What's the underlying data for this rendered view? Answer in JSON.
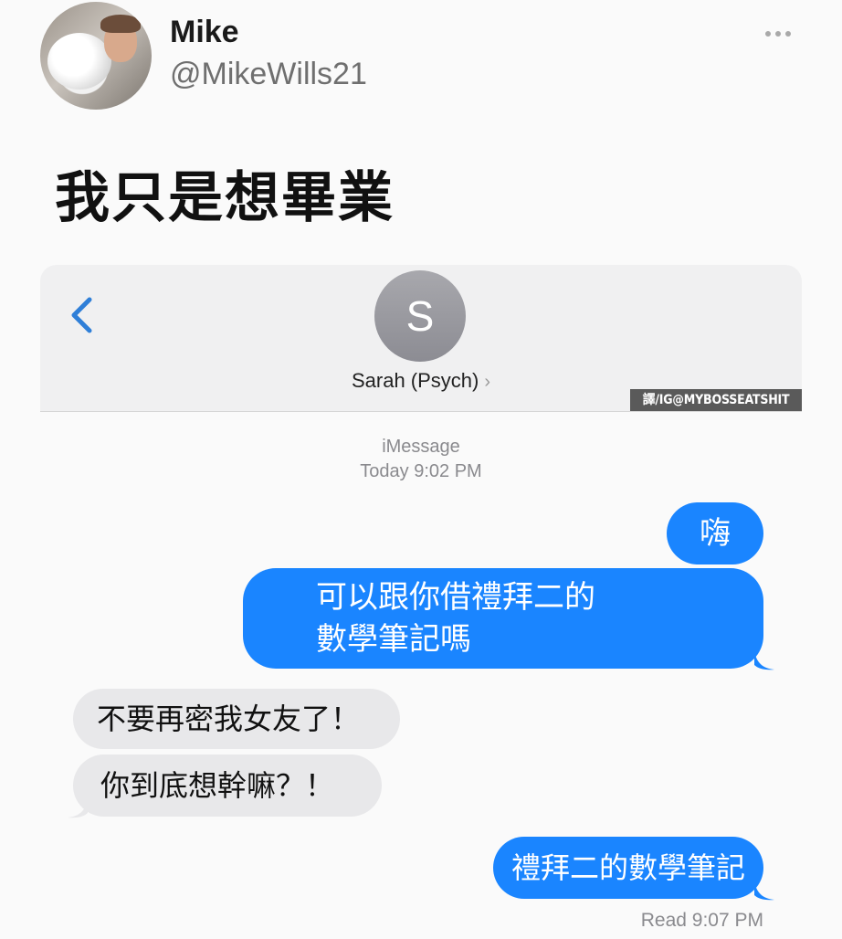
{
  "tweet": {
    "user_name": "Mike",
    "user_handle": "@MikeWills21",
    "text": "我只是想畢業"
  },
  "conversation": {
    "contact_initial": "S",
    "contact_name": "Sarah (Psych)",
    "watermark": "譯/IG@MYBOSSEATSHIT",
    "service": "iMessage",
    "timestamp": "Today 9:02 PM",
    "messages": [
      {
        "direction": "sent",
        "text": "嗨"
      },
      {
        "direction": "sent",
        "line1": "可以跟你借禮拜二的",
        "line2": "數學筆記嗎"
      },
      {
        "direction": "received",
        "text": "不要再密我女友了！"
      },
      {
        "direction": "received",
        "text": "你到底想幹嘛？！"
      },
      {
        "direction": "sent",
        "text": "禮拜二的數學筆記"
      }
    ],
    "read_receipt": "Read 9:07 PM"
  },
  "colors": {
    "sent_bubble": "#1a85ff",
    "received_bubble": "#e8e8ea",
    "back_chevron": "#2f7fd8"
  },
  "icons": [
    "more-icon",
    "back-chevron-icon",
    "contact-chevron-icon"
  ]
}
